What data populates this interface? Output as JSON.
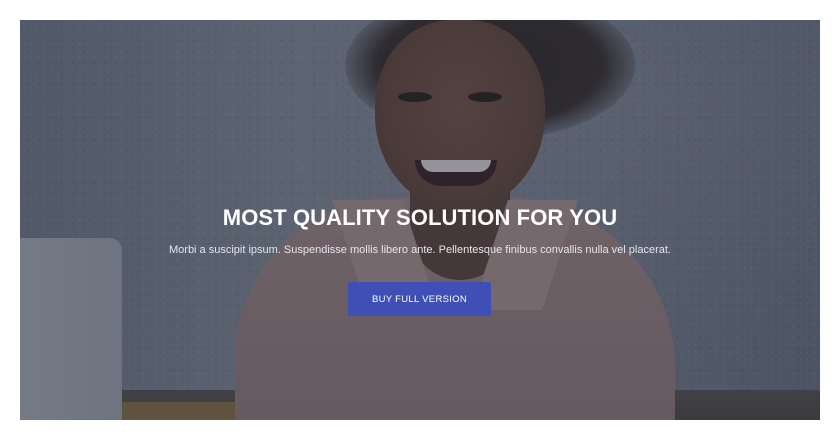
{
  "hero": {
    "title": "MOST QUALITY SOLUTION FOR YOU",
    "subtitle": "Morbi a suscipit ipsum. Suspendisse mollis libero ante. Pellentesque finibus convallis nulla vel placerat.",
    "button_label": "BUY FULL VERSION"
  },
  "colors": {
    "button": "#3f4fb5",
    "overlay": "#20263a",
    "page_background": "#ffffff"
  },
  "background_image": {
    "icon": "hero-photo-woman-smiling"
  }
}
